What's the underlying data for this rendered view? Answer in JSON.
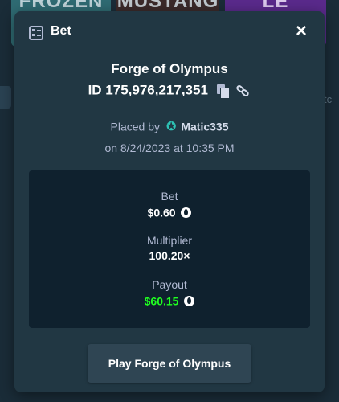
{
  "background": {
    "thumbnails": [
      "FROZEN",
      "MUSTANG",
      "LE"
    ],
    "side_hint": "tc"
  },
  "modal": {
    "title": "Bet",
    "header_icon": "bet-slip-icon",
    "close_symbol": "×"
  },
  "bet": {
    "game": "Forge of Olympus",
    "id_label": "ID 175,976,217,351",
    "placed_by_label": "Placed by",
    "user_icon": "vip-star-icon",
    "username": "Matic335",
    "placed_on": "on 8/24/2023 at 10:35 PM"
  },
  "stats": {
    "bet_label": "Bet",
    "bet_value": "$0.60",
    "multiplier_label": "Multiplier",
    "multiplier_value": "100.20×",
    "payout_label": "Payout",
    "payout_value": "$60.15",
    "currency_icon": "eos-coin-icon"
  },
  "actions": {
    "play_label": "Play Forge of Olympus"
  },
  "colors": {
    "background": "#1a2c38",
    "modal": "#213743",
    "stats_box": "#0f212e",
    "button": "#2f4553",
    "payout_green": "#1fff20",
    "muted_text": "#b1bad3"
  }
}
